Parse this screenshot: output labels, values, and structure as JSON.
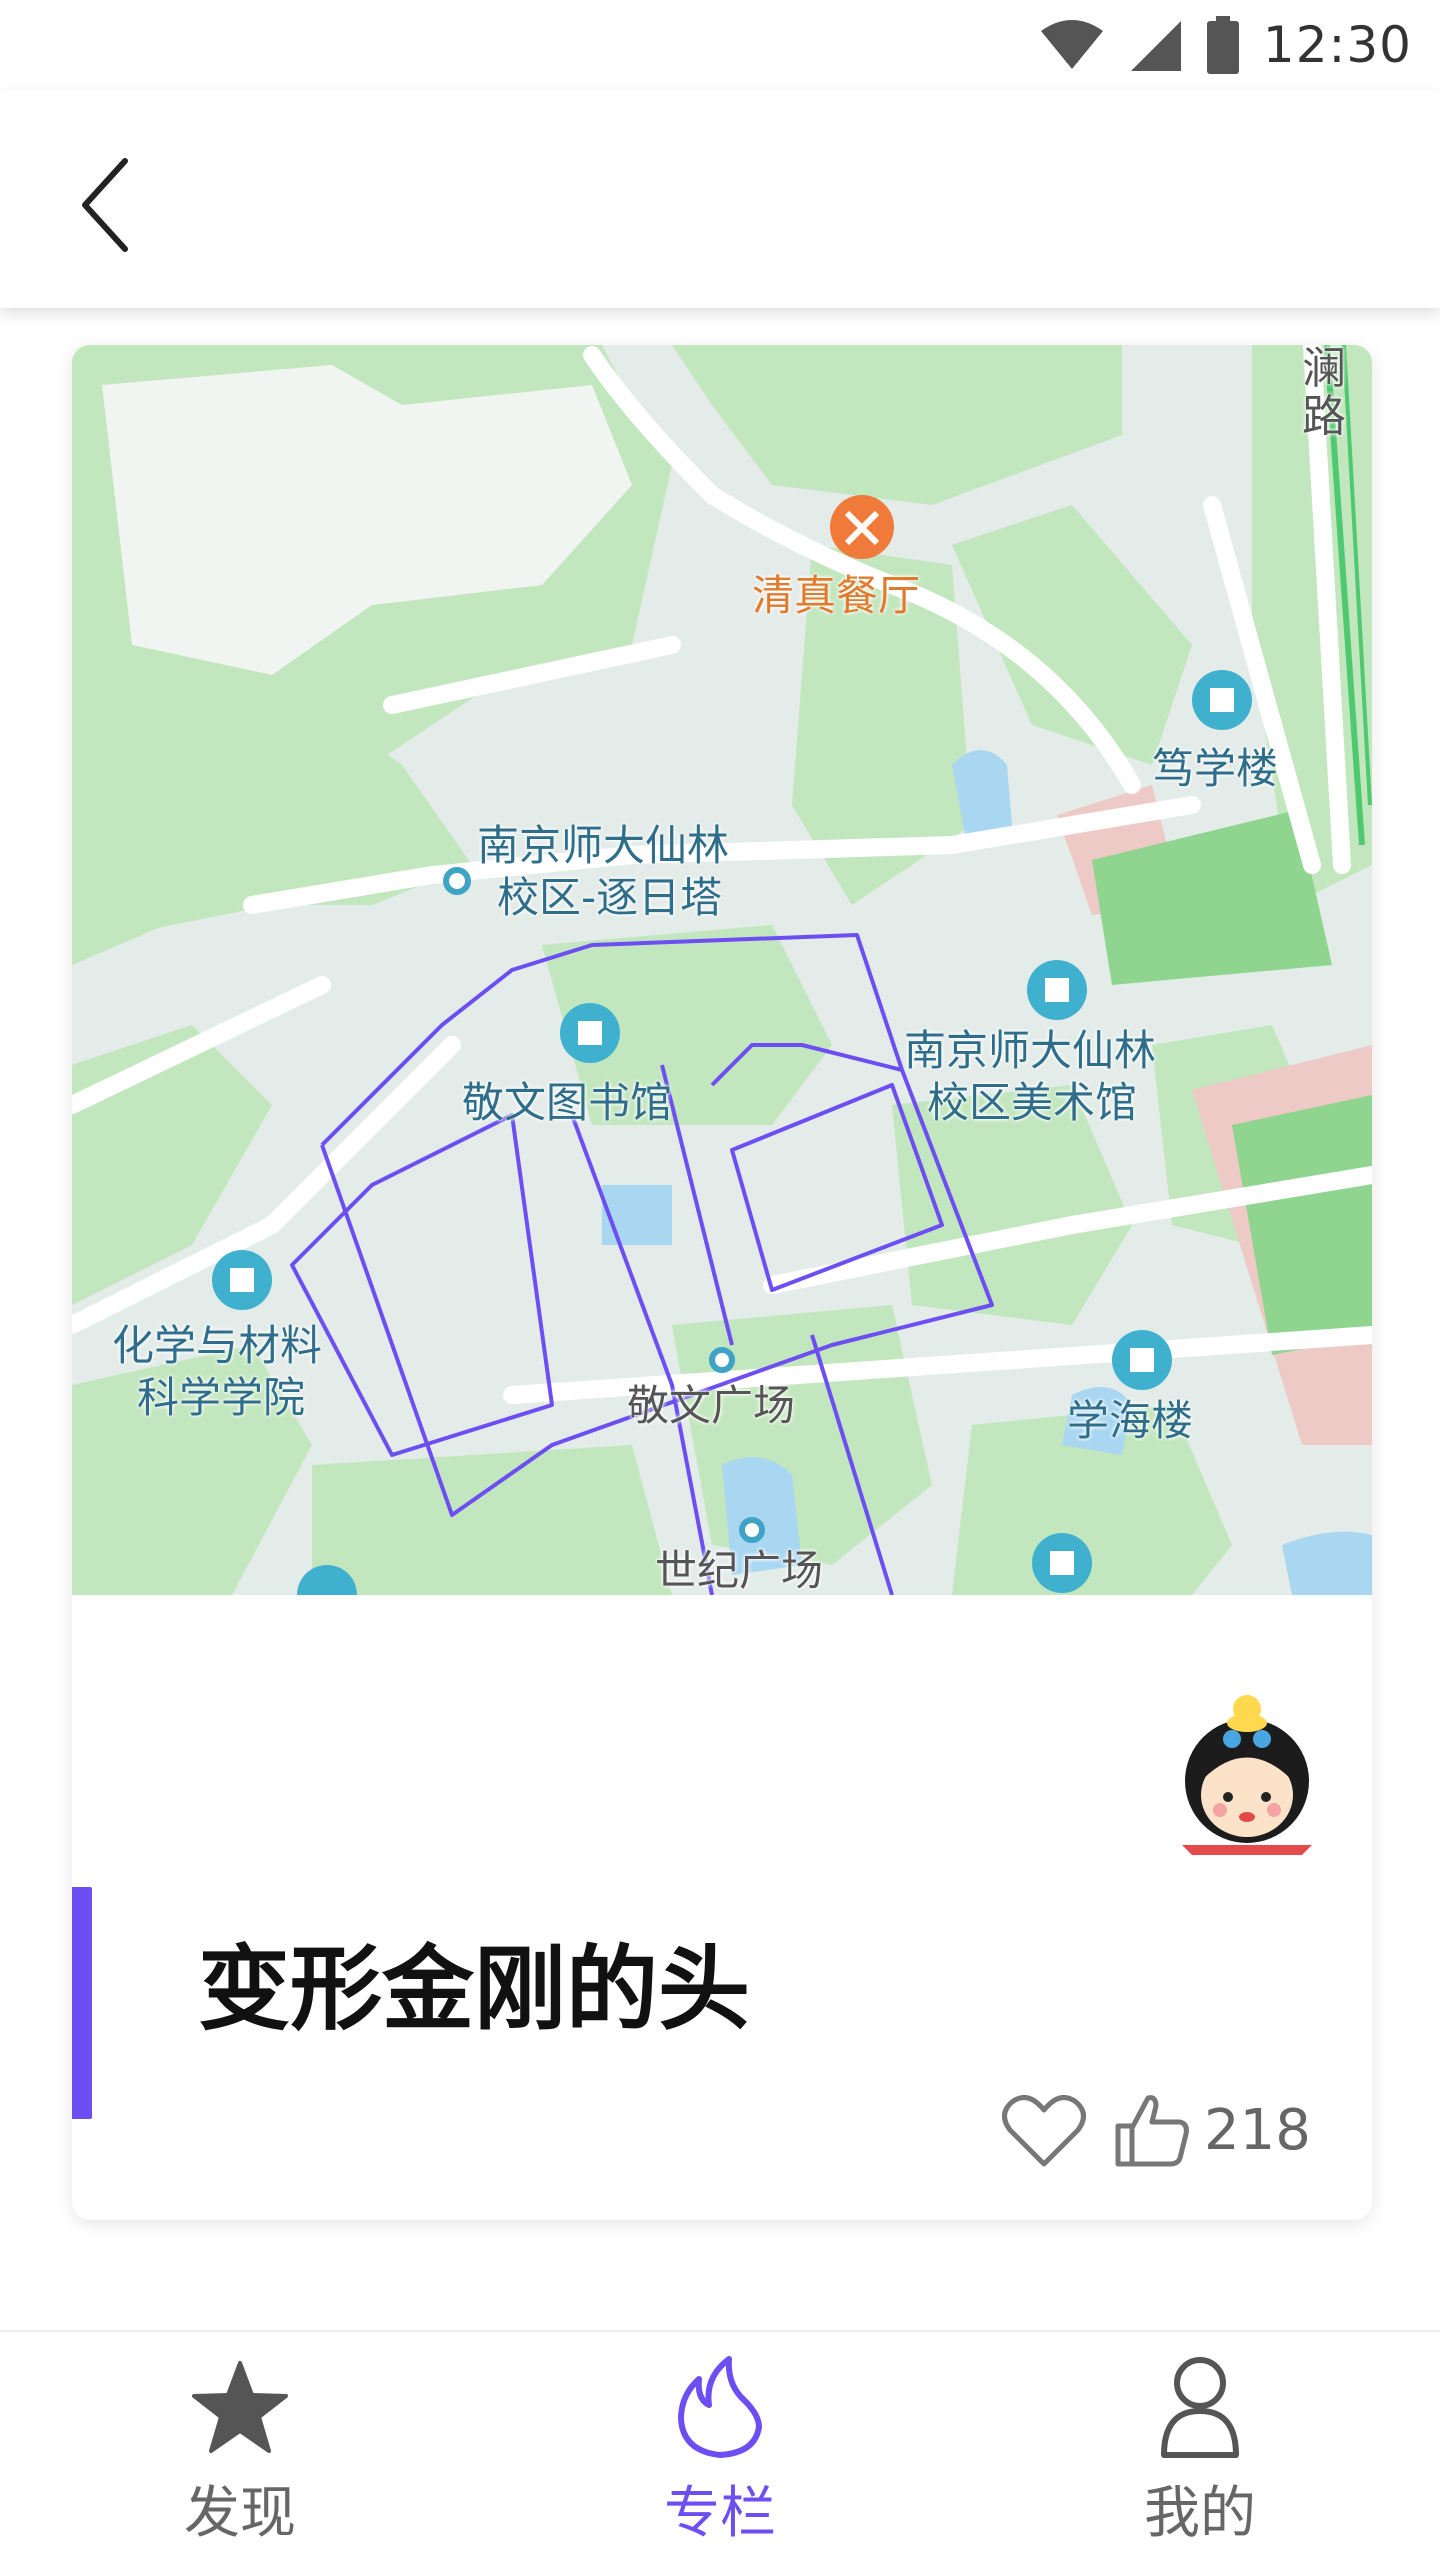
{
  "status_bar": {
    "time": "12:30"
  },
  "header": {
    "back_icon": "chevron-left-icon"
  },
  "card": {
    "map": {
      "labels": {
        "restaurant": "清真餐厅",
        "road": "澜\n路",
        "dushi": "笃学楼",
        "zhuri_line1": "南京师大仙林",
        "zhuri_line2": "校区-逐日塔",
        "library": "敬文图书馆",
        "art_line1": "南京师大仙林",
        "art_line2": "校区美术馆",
        "chem_line1": "化学与材料",
        "chem_line2": "科学学院",
        "jingwen_square": "敬文广场",
        "xuehai": "学海楼",
        "century_square": "世纪广场"
      },
      "colors": {
        "route": "#6c4ef2",
        "water": "#a9d7f2",
        "green": "#c2e6bd",
        "sports": "#eecac7"
      }
    },
    "title": "变形金刚的头",
    "like_count": "218",
    "accent_color": "#6c4ef2"
  },
  "bottom_nav": {
    "items": [
      {
        "label": "发现",
        "icon": "star-icon"
      },
      {
        "label": "专栏",
        "icon": "flame-icon"
      },
      {
        "label": "我的",
        "icon": "person-icon"
      }
    ],
    "active_color": "#6c4ef2",
    "inactive_color": "#666666"
  }
}
